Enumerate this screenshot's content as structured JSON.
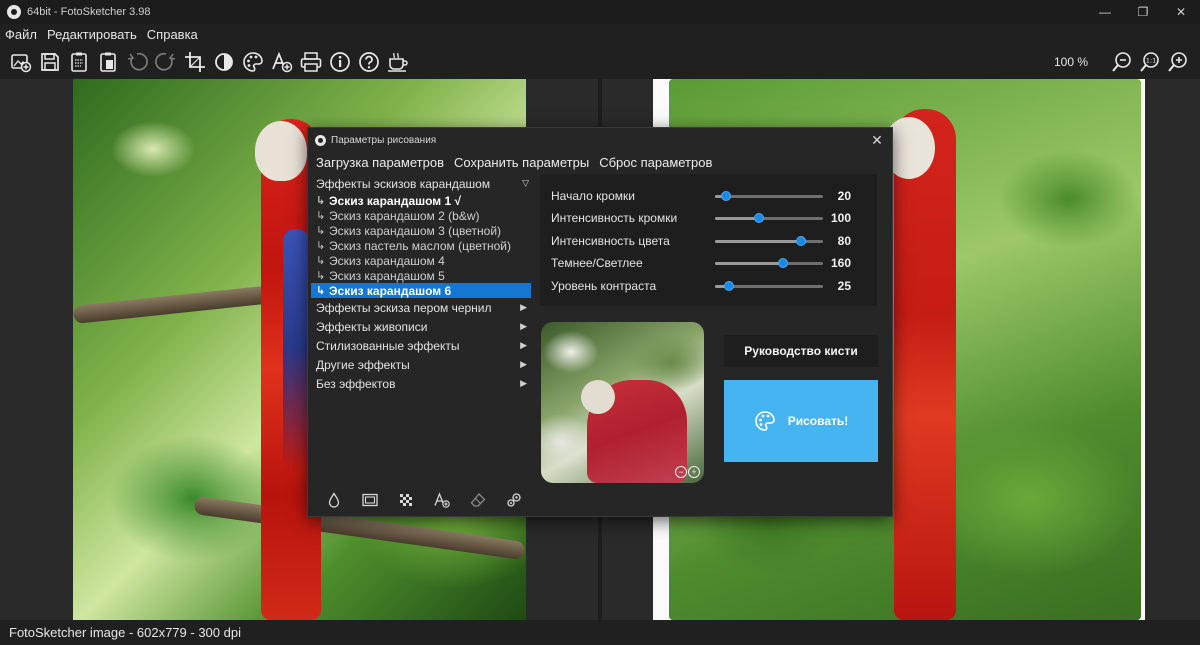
{
  "window": {
    "title": "64bit - FotoSketcher 3.98",
    "controls": [
      "—",
      "❐",
      "✕"
    ]
  },
  "menu": [
    "Файл",
    "Редактировать",
    "Справка"
  ],
  "toolbar": {
    "icons": [
      "new-image-icon",
      "save-icon",
      "copy-icon",
      "paste-icon",
      "undo-icon",
      "redo-icon",
      "crop-icon",
      "contrast-icon",
      "palette-icon",
      "text-icon",
      "print-icon",
      "info-icon",
      "help-icon",
      "coffee-icon"
    ],
    "zoom_level": "100 %",
    "zoom_icons": [
      "zoom-out-icon",
      "zoom-actual-icon",
      "zoom-in-icon"
    ]
  },
  "status": {
    "text": "FotoSketcher image - 602x779 - 300 dpi"
  },
  "dialog": {
    "title": "Параметры рисования",
    "close": "✕",
    "menu": [
      "Загрузка параметров",
      "Сохранить параметры",
      "Сброс параметров"
    ],
    "categories": [
      {
        "label": "Эффекты эскизов карандашом",
        "expanded": true,
        "items": [
          {
            "label": "Эскиз карандашом 1 √",
            "state": "bold"
          },
          {
            "label": "Эскиз карандашом 2 (b&w)",
            "state": "normal"
          },
          {
            "label": "Эскиз карандашом 3 (цветной)",
            "state": "normal"
          },
          {
            "label": "Эскиз пастель маслом (цветной)",
            "state": "normal"
          },
          {
            "label": "Эскиз карандашом 4",
            "state": "normal"
          },
          {
            "label": "Эскиз карандашом 5",
            "state": "normal"
          },
          {
            "label": "Эскиз карандашом 6",
            "state": "selected"
          }
        ]
      },
      {
        "label": "Эффекты эскиза пером чернил",
        "expanded": false
      },
      {
        "label": "Эффекты живописи",
        "expanded": false
      },
      {
        "label": "Стилизованные эффекты",
        "expanded": false
      },
      {
        "label": "Другие эффекты",
        "expanded": false
      },
      {
        "label": "Без эффектов",
        "expanded": false
      }
    ],
    "params": [
      {
        "label": "Начало кромки",
        "value": "20",
        "fraction": 0.1
      },
      {
        "label": "Интенсивность кромки",
        "value": "100",
        "fraction": 0.41
      },
      {
        "label": "Интенсивность цвета",
        "value": "80",
        "fraction": 0.8
      },
      {
        "label": "Темнее/Светлее",
        "value": "160",
        "fraction": 0.63
      },
      {
        "label": "Уровень контраста",
        "value": "25",
        "fraction": 0.13
      }
    ],
    "brush_guide": "Руководство кисти",
    "draw_button": "Рисовать!",
    "preview_zoom": [
      "−",
      "+"
    ],
    "bottom_tools": [
      "drop-icon",
      "frame-icon",
      "texture-icon",
      "text-add-icon",
      "eraser-icon",
      "settings-icon"
    ],
    "colors": {
      "accent": "#1677d2",
      "draw_button": "#45b4f0",
      "slider_thumb": "#1a8ae6"
    }
  }
}
